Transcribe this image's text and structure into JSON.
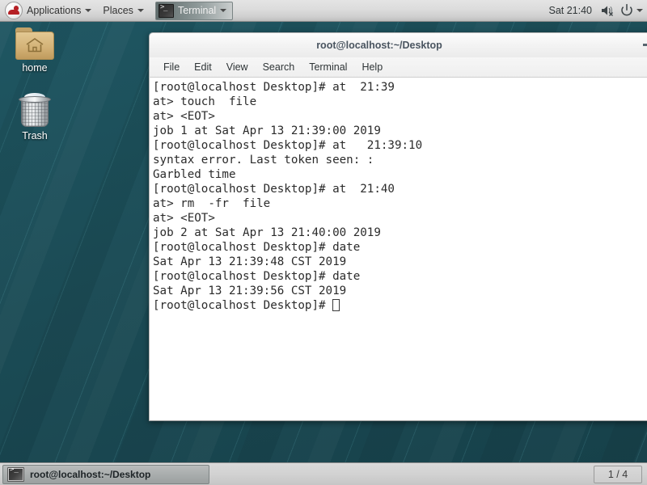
{
  "top_panel": {
    "logo_icon": "redhat-logo-icon",
    "applications_label": "Applications",
    "places_label": "Places",
    "window_item_label": "Terminal",
    "clock": "Sat 21:40",
    "volume_icon": "speaker-muted-icon",
    "power_icon": "power-icon",
    "system_caret_icon": "chevron-down-icon"
  },
  "desktop": {
    "icons": [
      {
        "name": "home",
        "label": "home",
        "icon": "home-folder-icon"
      },
      {
        "name": "trash",
        "label": "Trash",
        "icon": "trash-bin-icon"
      }
    ]
  },
  "terminal": {
    "title": "root@localhost:~/Desktop",
    "minimize_label": "Minimize",
    "menu": [
      {
        "label": "File"
      },
      {
        "label": "Edit"
      },
      {
        "label": "View"
      },
      {
        "label": "Search"
      },
      {
        "label": "Terminal"
      },
      {
        "label": "Help"
      }
    ],
    "lines": [
      "[root@localhost Desktop]# at  21:39",
      "at> touch  file",
      "at> <EOT>",
      "job 1 at Sat Apr 13 21:39:00 2019",
      "[root@localhost Desktop]# at   21:39:10",
      "syntax error. Last token seen: :",
      "Garbled time",
      "[root@localhost Desktop]# at  21:40",
      "at> rm  -fr  file",
      "at> <EOT>",
      "job 2 at Sat Apr 13 21:40:00 2019",
      "[root@localhost Desktop]# date",
      "Sat Apr 13 21:39:48 CST 2019",
      "[root@localhost Desktop]# date",
      "Sat Apr 13 21:39:56 CST 2019"
    ],
    "prompt": "[root@localhost Desktop]# "
  },
  "bottom_panel": {
    "task_label": "root@localhost:~/Desktop",
    "task_icon": "terminal-icon",
    "workspace_label": "1 / 4"
  },
  "colors": {
    "desktop_teal": "#1b4b55",
    "panel_gray": "#dcdcdc",
    "accent_red": "#b52025",
    "terminal_bg": "#ffffff",
    "terminal_fg": "#2b2b2b"
  }
}
